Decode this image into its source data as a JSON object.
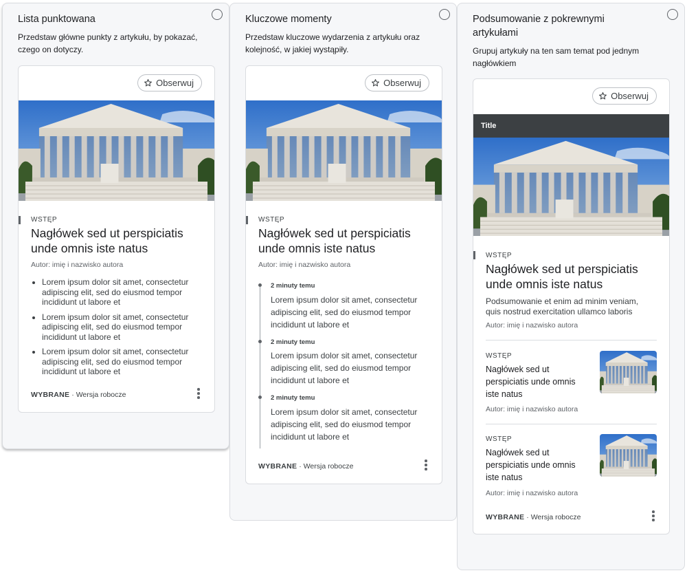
{
  "panels": [
    {
      "title": "Lista punktowana",
      "description_lines": [
        "Przedstaw główne punkty z artykułu, by pokazać,",
        "czego on dotyczy."
      ],
      "card": {
        "follow_label": "Obserwuj",
        "kicker": "WSTĘP",
        "headline_lines": [
          "Nagłówek sed ut perspiciatis",
          "unde omnis iste natus"
        ],
        "author": "Autor: imię i nazwisko autora",
        "bullets": [
          [
            "Lorem ipsum dolor sit amet, consectetur",
            "adipiscing elit, sed do eiusmod tempor",
            "incididunt ut labore et"
          ],
          [
            "Lorem ipsum dolor sit amet, consectetur",
            "adipiscing elit, sed do eiusmod tempor",
            "incididunt ut labore et"
          ],
          [
            "Lorem ipsum dolor sit amet, consectetur",
            "adipiscing elit, sed do eiusmod tempor",
            "incididunt ut labore et"
          ]
        ],
        "footer_bold": "WYBRANE",
        "footer_separator": "·",
        "footer_text": "Wersja robocze"
      }
    },
    {
      "title": "Kluczowe momenty",
      "description_lines": [
        "Przedstaw kluczowe wydarzenia z artykułu oraz",
        "kolejność, w jakiej wystąpiły."
      ],
      "card": {
        "follow_label": "Obserwuj",
        "kicker": "WSTĘP",
        "headline_lines": [
          "Nagłówek sed ut perspiciatis",
          "unde omnis iste natus"
        ],
        "author": "Autor: imię i nazwisko autora",
        "moments": [
          {
            "time": "2 minuty temu",
            "text_lines": [
              "Lorem ipsum dolor sit amet, consectetur",
              "adipiscing elit, sed do eiusmod tempor",
              "incididunt ut labore et"
            ]
          },
          {
            "time": "2 minuty temu",
            "text_lines": [
              "Lorem ipsum dolor sit amet, consectetur",
              "adipiscing elit, sed do eiusmod tempor",
              "incididunt ut labore et"
            ]
          },
          {
            "time": "2 minuty temu",
            "text_lines": [
              "Lorem ipsum dolor sit amet, consectetur",
              "adipiscing elit, sed do eiusmod tempor",
              "incididunt ut labore et"
            ]
          }
        ],
        "footer_bold": "WYBRANE",
        "footer_separator": "·",
        "footer_text": "Wersja robocze"
      }
    },
    {
      "title_lines": [
        "Podsumowanie z pokrewnymi",
        "artykułami"
      ],
      "description_lines": [
        "Grupuj artykuły na ten sam temat pod jednym",
        "nagłówkiem"
      ],
      "card": {
        "follow_label": "Obserwuj",
        "titlebar": "Title",
        "kicker": "WSTĘP",
        "headline_lines": [
          "Nagłówek sed ut perspiciatis",
          "unde omnis iste natus"
        ],
        "summary_lines": [
          "Podsumowanie et enim ad minim veniam,",
          "quis nostrud exercitation ullamco laboris"
        ],
        "author": "Autor: imię i nazwisko autora",
        "related": [
          {
            "kicker": "WSTĘP",
            "title_lines": [
              "Nagłówek sed ut",
              "perspiciatis unde omnis",
              "iste natus"
            ],
            "author": "Autor: imię i nazwisko autora"
          },
          {
            "kicker": "WSTĘP",
            "title_lines": [
              "Nagłówek sed ut",
              "perspiciatis unde omnis",
              "iste natus"
            ],
            "author": "Autor: imię i nazwisko autora"
          }
        ],
        "footer_bold": "WYBRANE",
        "footer_separator": "·",
        "footer_text": "Wersja robocze"
      }
    }
  ],
  "colors": {
    "panel_bg": "#f6f7f9",
    "border": "#dadce0",
    "text": "#202124",
    "titlebar": "#3c4043"
  },
  "icons": [
    "star-outline-icon",
    "more-vert-icon",
    "radio-unchecked-icon"
  ]
}
